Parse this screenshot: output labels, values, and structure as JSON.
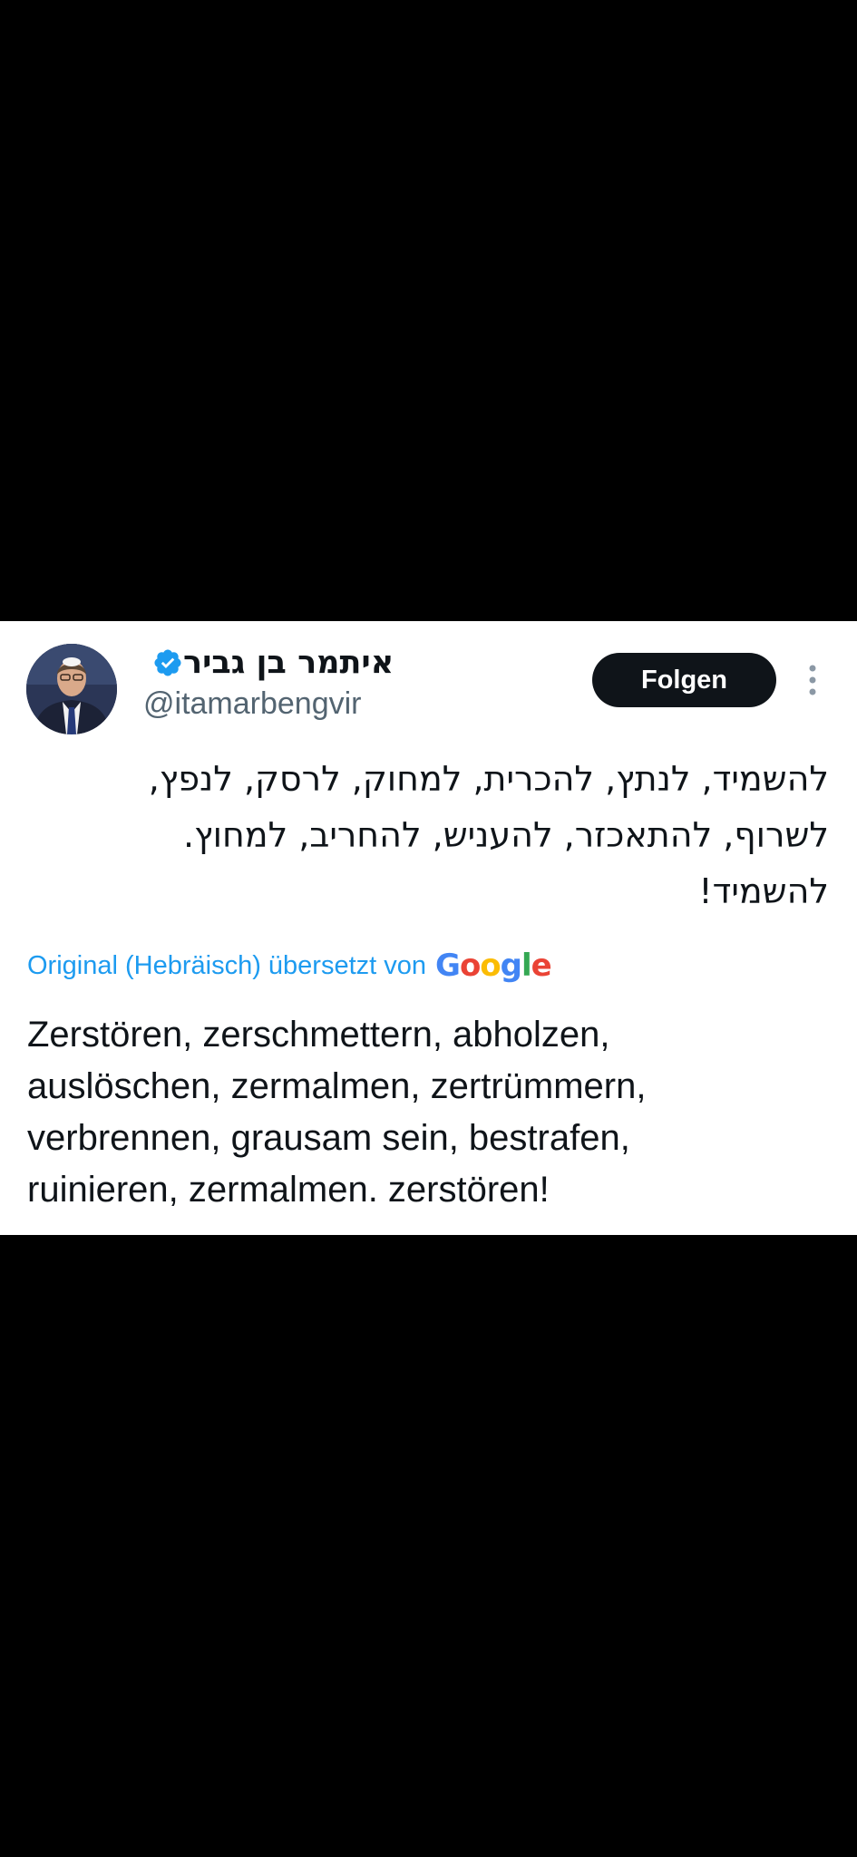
{
  "tweet": {
    "author": {
      "display_name": "איתמר בן גביר",
      "handle": "@itamarbengvir",
      "verified": true
    },
    "follow_label": "Folgen",
    "more_icon": "more-vertical-icon",
    "original_lines": [
      "להשמיד, לנתץ, להכרית, למחוק, לרסק, לנפץ,",
      "לשרוף, להתאכזר, להעניש, להחריב, למחוץ.",
      "להשמיד!"
    ],
    "translation_label": "Original (Hebräisch) übersetzt von",
    "translation_provider": "Google",
    "translated_lines": [
      "Zerstören, zerschmettern, abholzen,",
      "auslöschen, zermalmen, zertrümmern,",
      "verbrennen, grausam sein, bestrafen,",
      "ruinieren, zermalmen. zerstören!"
    ]
  },
  "colors": {
    "background": "#000000",
    "card": "#ffffff",
    "text": "#0f1419",
    "secondary_text": "#536471",
    "link": "#1d9bf0",
    "verified": "#1d9bf0",
    "button_bg": "#0f1419",
    "google_blue": "#4285F4",
    "google_red": "#EA4335",
    "google_yellow": "#FBBC05",
    "google_green": "#34A853"
  }
}
